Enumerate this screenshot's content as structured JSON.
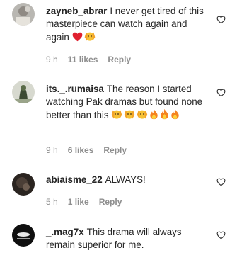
{
  "comments": [
    {
      "username": "zayneb_abrar",
      "text": "I never get tired of this masterpiece can watch again and again",
      "emojis": [
        "red-heart",
        "hands-face"
      ],
      "time": "9 h",
      "likes": "11 likes",
      "reply": "Reply"
    },
    {
      "username": "its._.rumaisa",
      "text": "The reason I started watching Pak dramas but found none better than this",
      "emojis": [
        "hands-face",
        "hands-face",
        "hands-face",
        "fire",
        "fire",
        "fire"
      ],
      "time": "9 h",
      "likes": "6 likes",
      "reply": "Reply"
    },
    {
      "username": "abiaisme_22",
      "text": "ALWAYS!",
      "emojis": [],
      "time": "5 h",
      "likes": "1 like",
      "reply": "Reply"
    },
    {
      "username": "_.mag7x",
      "text": "This drama will always remain superior for me.",
      "emojis": [],
      "time": "",
      "likes": "",
      "reply": ""
    }
  ],
  "colors": {
    "text": "#262626",
    "meta": "#8e8e8e",
    "heart_emoji": "#e0202f",
    "fire": "#f58220"
  }
}
